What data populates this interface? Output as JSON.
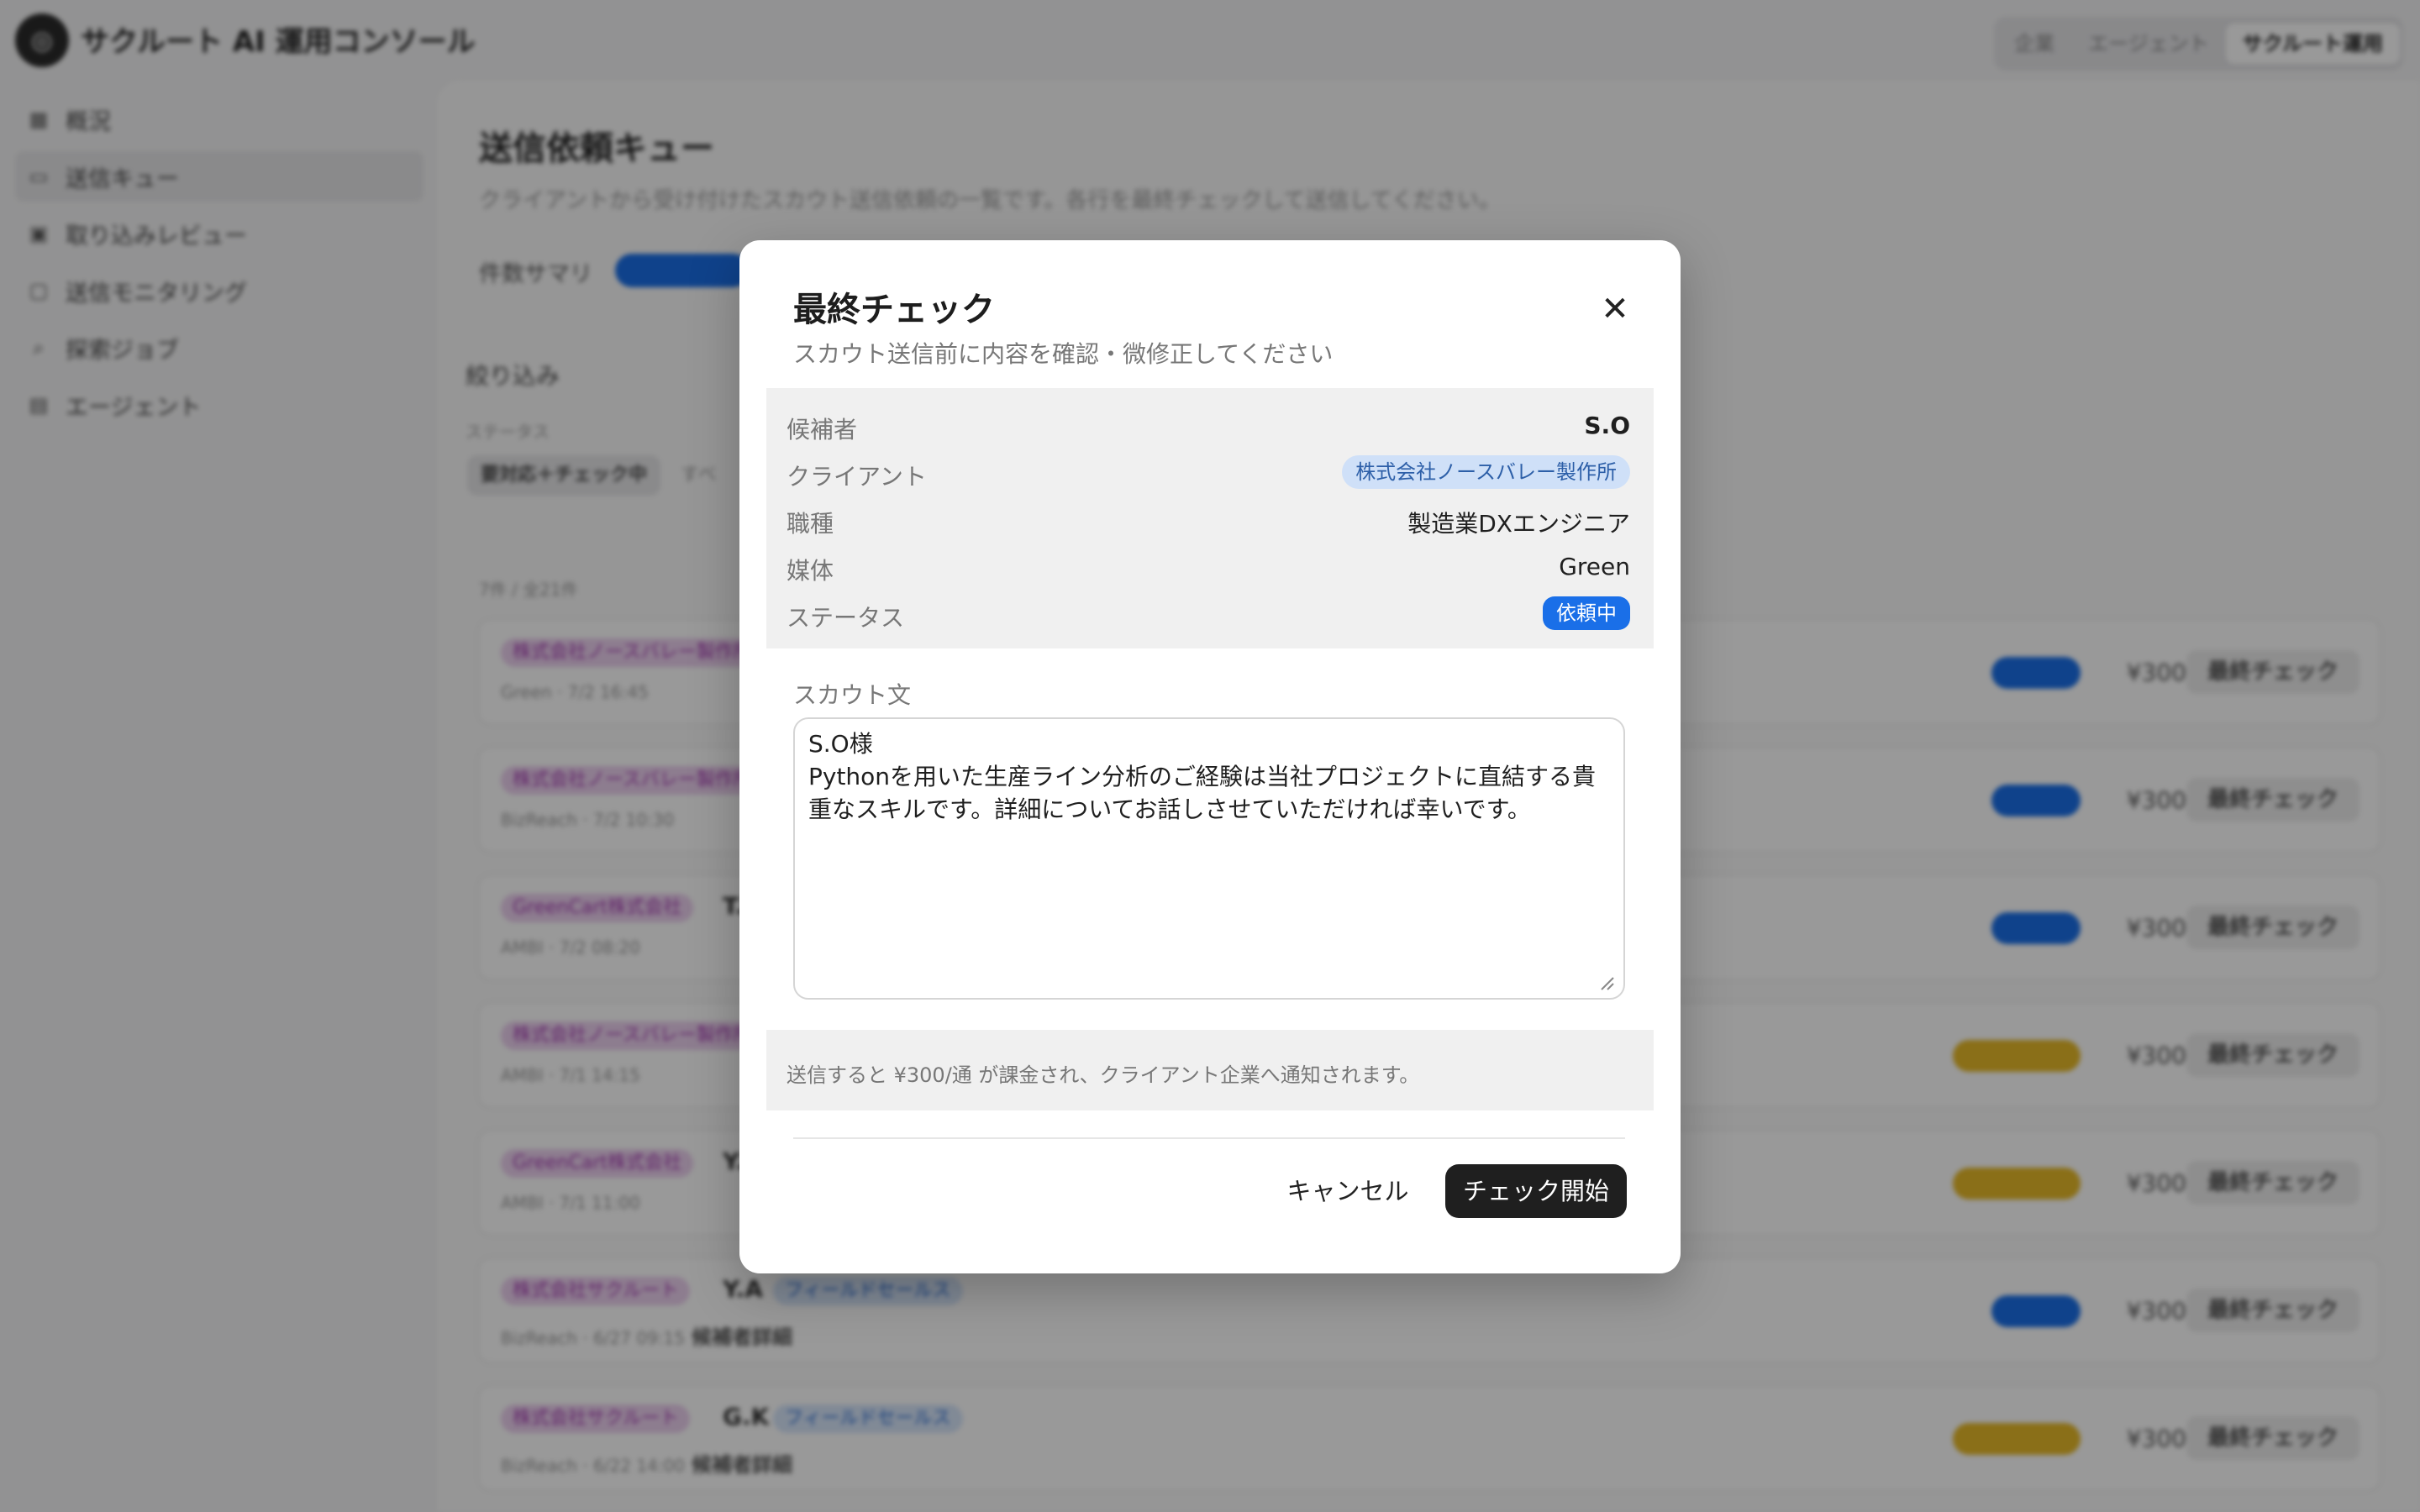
{
  "app": {
    "title": "サクルート AI 運用コンソール",
    "nav_tabs": [
      "企業",
      "エージェント",
      "サクルート運用"
    ]
  },
  "sidebar": {
    "items": [
      {
        "label": "概況",
        "icon": "grid-icon"
      },
      {
        "label": "送信キュー",
        "icon": "inbox-icon"
      },
      {
        "label": "取り込みレビュー",
        "icon": "review-icon"
      },
      {
        "label": "送信モニタリング",
        "icon": "chat-icon"
      },
      {
        "label": "探索ジョブ",
        "icon": "search-job-icon"
      },
      {
        "label": "エージェント",
        "icon": "briefcase-icon"
      }
    ]
  },
  "main": {
    "title": "送信依頼キュー",
    "subtitle": "クライアントから受け付けたスカウト送信依頼の一覧です。各行を最終チェックして送信してください。",
    "summary_label": "件数サマリ",
    "filter_title": "絞り込み",
    "filter_status_label": "ステータス",
    "filter_chip": "要対応＋チェック中",
    "count_text": "7件 / 全21件",
    "rows": [
      {
        "client": "株式会社ノースバレー製作所",
        "name": "",
        "role": "",
        "meta": "Green · 7/2 16:45",
        "link": "",
        "price": "¥300",
        "action": "最終チェック",
        "status_color": "blue"
      },
      {
        "client": "株式会社ノースバレー製作所",
        "name": "",
        "role": "",
        "meta": "BizReach · 7/2 10:30",
        "link": "",
        "price": "¥300",
        "action": "最終チェック",
        "status_color": "blue"
      },
      {
        "client": "GreenCart株式会社",
        "name": "T.",
        "role": "",
        "meta": "AMBI · 7/2 08:20",
        "link": "",
        "price": "¥300",
        "action": "最終チェック",
        "status_color": "blue"
      },
      {
        "client": "株式会社ノースバレー製作所",
        "name": "",
        "role": "",
        "meta": "AMBI · 7/1 14:15",
        "link": "",
        "price": "¥300",
        "action": "最終チェック",
        "status_color": "yellow"
      },
      {
        "client": "GreenCart株式会社",
        "name": "Y.",
        "role": "",
        "meta": "AMBI · 7/1 11:00",
        "link": "",
        "price": "¥300",
        "action": "最終チェック",
        "status_color": "yellow"
      },
      {
        "client": "株式会社サクルート",
        "name": "Y.A",
        "role": "フィールドセールス",
        "meta": "BizReach · 6/27 09:15",
        "link": "候補者詳細",
        "price": "¥300",
        "action": "最終チェック",
        "status_color": "blue"
      },
      {
        "client": "株式会社サクルート",
        "name": "G.K",
        "role": "フィールドセールス",
        "meta": "BizReach · 6/22 14:00",
        "link": "候補者詳細",
        "price": "¥300",
        "action": "最終チェック",
        "status_color": "yellow"
      }
    ]
  },
  "modal": {
    "title": "最終チェック",
    "subtitle": "スカウト送信前に内容を確認・微修正してください",
    "close_icon": "close-icon",
    "info": {
      "candidate_label": "候補者",
      "candidate_value": "S.O",
      "client_label": "クライアント",
      "client_value": "株式会社ノースバレー製作所",
      "job_label": "職種",
      "job_value": "製造業DXエンジニア",
      "media_label": "媒体",
      "media_value": "Green",
      "status_label": "ステータス",
      "status_value": "依頼中"
    },
    "scout_label": "スカウト文",
    "scout_text": "S.O様\nPythonを用いた生産ライン分析のご経験は当社プロジェクトに直結する貴重なスキルです。詳細についてお話しさせていただければ幸いです。",
    "note": "送信すると ¥300/通 が課金され、クライアント企業へ通知されます。",
    "cancel_label": "キャンセル",
    "start_label": "チェック開始"
  },
  "colors": {
    "accent_blue": "#1a6fe8",
    "warning_yellow": "#e7b928",
    "primary_button": "#1f1f1f"
  }
}
